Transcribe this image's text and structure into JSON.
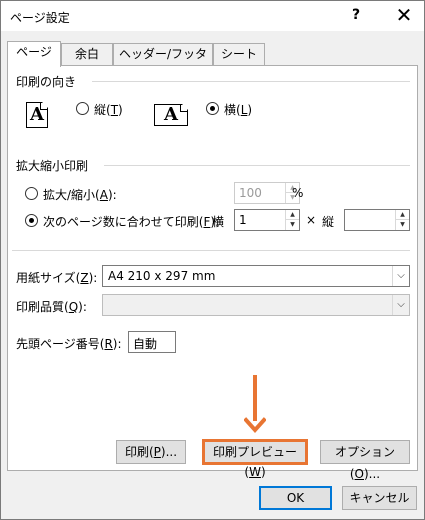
{
  "window": {
    "title": "ページ設定",
    "help_glyph": "?",
    "close_glyph": "✕"
  },
  "tabs": [
    {
      "label": "ページ",
      "active": true
    },
    {
      "label": "余白",
      "active": false
    },
    {
      "label": "ヘッダー/フッター",
      "active": false
    },
    {
      "label": "シート",
      "active": false
    }
  ],
  "orientation": {
    "group_label": "印刷の向き",
    "portrait_label_pre": "縦(",
    "portrait_key": "T",
    "portrait_label_post": ")",
    "portrait_icon": "A",
    "landscape_label_pre": "横(",
    "landscape_key": "L",
    "landscape_label_post": ")",
    "landscape_icon": "A",
    "selected": "landscape"
  },
  "scaling": {
    "group_label": "拡大縮小印刷",
    "zoom_label_pre": "拡大/縮小(",
    "zoom_key": "A",
    "zoom_label_post": "):",
    "zoom_value": "100",
    "zoom_unit": "%",
    "fit_label_pre": "次のページ数に合わせて印刷(",
    "fit_key": "F",
    "fit_label_post": "):",
    "fit_wide_label": "横",
    "fit_wide_value": "1",
    "times": "×",
    "fit_tall_label": "縦",
    "fit_tall_value": "",
    "selected": "fit"
  },
  "paper": {
    "size_label_pre": "用紙サイズ(",
    "size_key": "Z",
    "size_label_post": "):",
    "size_value": "A4 210 x 297 mm",
    "quality_label_pre": "印刷品質(",
    "quality_key": "Q",
    "quality_label_post": "):",
    "quality_value": "",
    "first_page_label_pre": "先頭ページ番号(",
    "first_page_key": "R",
    "first_page_label_post": "):",
    "first_page_value": "自動"
  },
  "buttons": {
    "print_pre": "印刷(",
    "print_key": "P",
    "print_post": ")...",
    "preview_pre": "印刷プレビュー(",
    "preview_key": "W",
    "preview_post": ")",
    "options_pre": "オプション(",
    "options_key": "O",
    "options_post": ")...",
    "ok": "OK",
    "cancel": "キャンセル"
  },
  "annotation": {
    "arrow_color": "#e87533",
    "highlight_color": "#e87533"
  },
  "colors": {
    "default_button_border": "#0078d7",
    "dialog_bg": "#f0f0f0"
  }
}
